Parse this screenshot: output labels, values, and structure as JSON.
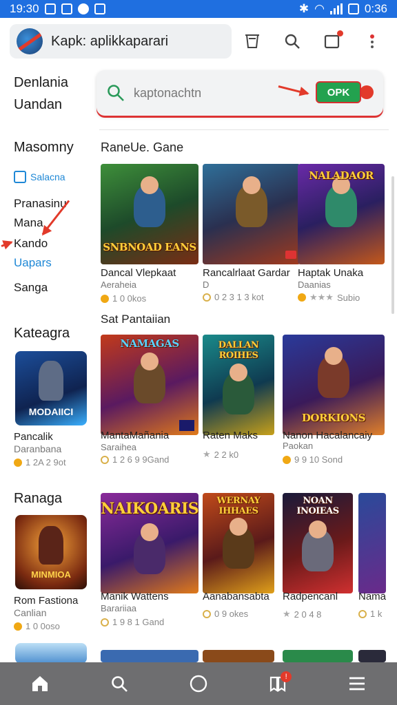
{
  "status_bar": {
    "time": "19:30",
    "right_text": "0:36"
  },
  "app_bar": {
    "title": "Kapk: aplikkaparari"
  },
  "search": {
    "placeholder": "kaptonachtn",
    "go_label": "OPK"
  },
  "sidebar": {
    "heading1": "Denlania Uandan",
    "heading2": "Masomny",
    "saved_label": "Salacna",
    "items": [
      "Pranasinu",
      "Mana",
      "Kando",
      "Uapars",
      "Sanga"
    ],
    "heading3": "Kateagra",
    "card1": {
      "title": "MODAIICI",
      "name": "Pancalik",
      "sub": "Daranbana",
      "meta": "1 2A 2 9ot"
    },
    "heading4": "Ranaga",
    "card2": {
      "title": "MINMIOA",
      "name": "Rom Fastiona",
      "sub": "Canlian",
      "meta": "1 0 0oso"
    }
  },
  "sections": [
    {
      "title": "RaneUe. Gane",
      "games": [
        {
          "art": "SNBNOAD EANS",
          "name": "Dancal Vlepkaat",
          "sub": "Aeraheia",
          "meta": "1 0 0kos"
        },
        {
          "art": "",
          "name": "Rancalrlaat Gardar",
          "sub": "D",
          "meta": "0 2 3 1 3 kot"
        },
        {
          "art": "NALADAOR",
          "name": "Haptak Unaka",
          "sub": "Daanias",
          "meta": "Subio"
        }
      ]
    },
    {
      "title": "Sat Pantaiian",
      "games": [
        {
          "art": "NAMAGAS",
          "name": "MantaMañania",
          "sub": "Saraihea",
          "meta": "1 2 6 9 9Gand"
        },
        {
          "art": "DALLAN ROIHES",
          "name": "Raten Maks",
          "sub": "",
          "meta": "2 2 k0"
        },
        {
          "art": "DORKIONS",
          "name": "Nanon Hacalancaiy",
          "sub": "Paokan",
          "meta": "9 9 10 Sond"
        }
      ]
    },
    {
      "title": "",
      "games": [
        {
          "art": "NAIKOARIS",
          "name": "Manik Wattens",
          "sub": "Barariiaa",
          "meta": "1 9 8 1 Gand"
        },
        {
          "art": "WERNAY IHHAES",
          "name": "Aanabansabta",
          "sub": "",
          "meta": "0 9 okes"
        },
        {
          "art": "NOAN INOIEAS",
          "name": "Radpencanl",
          "sub": "",
          "meta": "2 0 4 8"
        },
        {
          "art": "",
          "name": "Nama",
          "sub": "",
          "meta": "1 k"
        }
      ]
    }
  ],
  "bottom_nav": [
    "home-icon",
    "search-icon",
    "circle-icon",
    "bookmarks-icon",
    "menu-icon"
  ]
}
